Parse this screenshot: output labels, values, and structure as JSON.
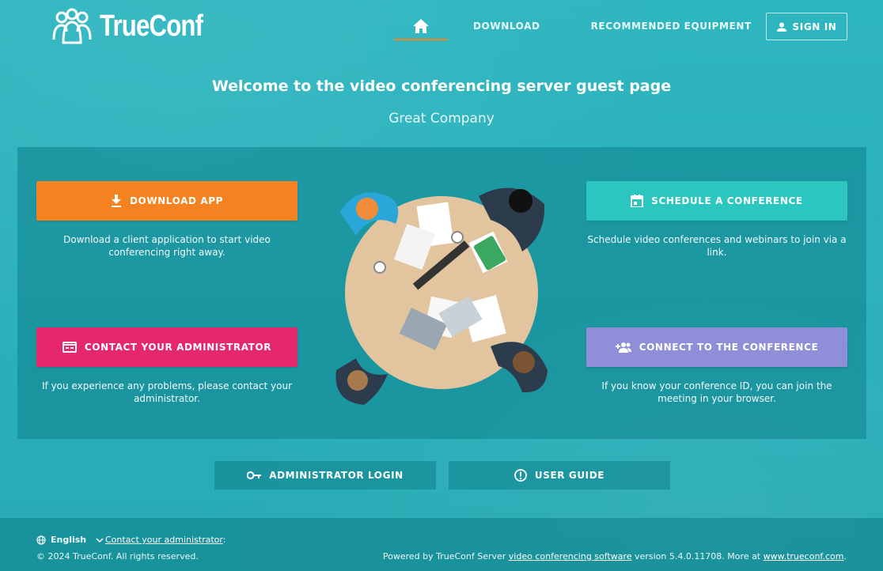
{
  "header": {
    "logo_text": "TrueConf",
    "nav": {
      "home_icon": "home-icon",
      "download": "DOWNLOAD",
      "equipment": "RECOMMENDED EQUIPMENT"
    },
    "signin_label": "SIGN IN"
  },
  "hero": {
    "title": "Welcome to the video conferencing server guest page",
    "company": "Great Company"
  },
  "actions": {
    "download": {
      "label": "DOWNLOAD APP",
      "desc": "Download a client application to start video conferencing right away.",
      "icon": "download-icon",
      "color": "#f58220"
    },
    "schedule": {
      "label": "SCHEDULE A CONFERENCE",
      "desc": "Schedule video conferences and webinars to join via a link.",
      "icon": "calendar-icon",
      "color": "#2cc6c0"
    },
    "contact": {
      "label": "CONTACT YOUR ADMINISTRATOR",
      "desc": "If you experience any problems, please contact your administrator.",
      "icon": "card-icon",
      "color": "#e5286d"
    },
    "connect": {
      "label": "CONNECT TO THE CONFERENCE",
      "desc": "If you know your conference ID, you can join the meeting in your browser.",
      "icon": "add-group-icon",
      "color": "#8e8fd8"
    }
  },
  "secondary": {
    "admin_login": "ADMINISTRATOR LOGIN",
    "user_guide": "USER GUIDE"
  },
  "footer": {
    "language": "English",
    "contact_link": "Contact your administrator",
    "contact_suffix": ":",
    "copyright": "© 2024 TrueConf. All rights reserved.",
    "powered_prefix": "Powered by TrueConf Server ",
    "powered_link": "video conferencing software",
    "version_text": " version 5.4.0.11708. More at ",
    "site_link": "www.trueconf.com",
    "end": "."
  }
}
